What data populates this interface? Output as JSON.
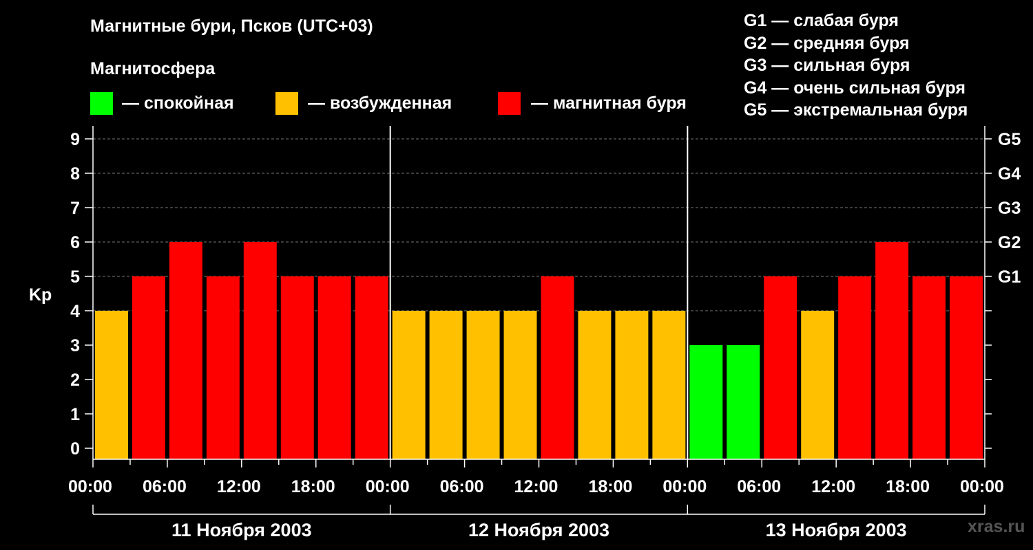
{
  "header": {
    "title": "Магнитные бури, Псков (UTC+03)",
    "legend_heading": "Магнитосфера",
    "legend": [
      {
        "label": "— спокойная",
        "color": "#00ff00"
      },
      {
        "label": "— возбужденная",
        "color": "#ffc000"
      },
      {
        "label": "— магнитная буря",
        "color": "#ff0000"
      }
    ],
    "g_scale": [
      "G1 — слабая буря",
      "G2 — средняя буря",
      "G3 — сильная буря",
      "G4 — очень сильная буря",
      "G5 — экстремальная буря"
    ]
  },
  "watermark": "xras.ru",
  "chart_data": {
    "type": "bar",
    "title": "Магнитные бури, Псков (UTC+03)",
    "ylabel": "Kp",
    "ylim": [
      0,
      9
    ],
    "yticks": [
      "0",
      "1",
      "2",
      "3",
      "4",
      "5",
      "6",
      "7",
      "8",
      "9"
    ],
    "right_ticks": [
      {
        "value": 5,
        "label": "G1"
      },
      {
        "value": 6,
        "label": "G2"
      },
      {
        "value": 7,
        "label": "G3"
      },
      {
        "value": 8,
        "label": "G4"
      },
      {
        "value": 9,
        "label": "G5"
      }
    ],
    "grid": true,
    "colors": {
      "quiet": "#00ff00",
      "active": "#ffc000",
      "storm": "#ff0000"
    },
    "xtick_labels": [
      "00:00",
      "06:00",
      "12:00",
      "18:00",
      "00:00",
      "06:00",
      "12:00",
      "18:00",
      "00:00",
      "06:00",
      "12:00",
      "18:00",
      "00:00"
    ],
    "days": [
      {
        "label": "11 Ноября 2003",
        "values": [
          4,
          5,
          6,
          5,
          6,
          5,
          5,
          5
        ]
      },
      {
        "label": "12 Ноября 2003",
        "values": [
          4,
          4,
          4,
          4,
          5,
          4,
          4,
          4
        ]
      },
      {
        "label": "13 Ноября 2003",
        "values": [
          3,
          3,
          5,
          4,
          5,
          6,
          5,
          5
        ]
      }
    ]
  }
}
